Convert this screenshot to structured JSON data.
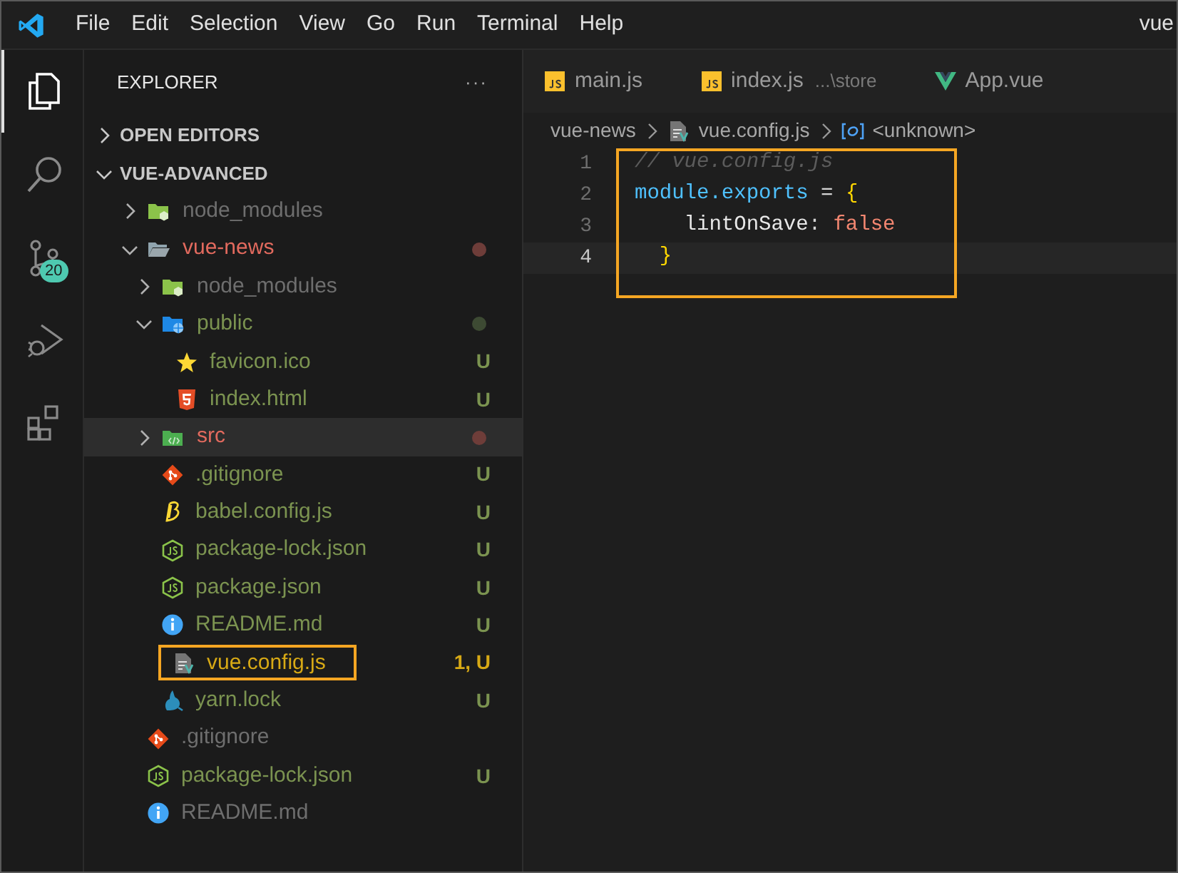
{
  "title_bar": {
    "menu": [
      "File",
      "Edit",
      "Selection",
      "View",
      "Go",
      "Run",
      "Terminal",
      "Help"
    ],
    "title": "vue"
  },
  "activity_bar": [
    {
      "kind": "explorer",
      "selected": true
    },
    {
      "kind": "search",
      "selected": false
    },
    {
      "kind": "source-control",
      "selected": false,
      "badge": "20"
    },
    {
      "kind": "run-debug",
      "selected": false
    },
    {
      "kind": "extensions",
      "selected": false
    }
  ],
  "sidebar": {
    "title": "EXPLORER",
    "more": "···",
    "sections": [
      {
        "label": "OPEN EDITORS",
        "expanded": false
      },
      {
        "label": "VUE-ADVANCED",
        "expanded": true
      }
    ],
    "tree": [
      {
        "name": "node_modules",
        "kind": "node-folder",
        "expanded": false,
        "color": "#6e6e6e",
        "hovered": false,
        "highlighted": false
      },
      {
        "name": "vue-news",
        "kind": "folder",
        "expanded": true,
        "color": "#e26a5e",
        "status_dot": {
          "color": "#6e3d39"
        },
        "hovered": false,
        "highlighted": false,
        "children": [
          {
            "name": "node_modules",
            "kind": "node-folder",
            "expanded": false,
            "color": "#6e6e6e",
            "hovered": false,
            "highlighted": false
          },
          {
            "name": "public",
            "kind": "public-folder",
            "expanded": true,
            "color": "#7b9350",
            "status_dot": {
              "color": "#3d4a33"
            },
            "hovered": false,
            "highlighted": false,
            "children": [
              {
                "name": "favicon.ico",
                "kind": "star",
                "color": "#7b9350",
                "decoration": "U",
                "hovered": false,
                "highlighted": false
              },
              {
                "name": "index.html",
                "kind": "html",
                "color": "#7b9350",
                "decoration": "U",
                "hovered": false,
                "highlighted": false
              }
            ]
          },
          {
            "name": "src",
            "kind": "src-folder",
            "expanded": false,
            "color": "#e26a5e",
            "status_dot": {
              "color": "#6e3d39"
            },
            "hovered": true,
            "highlighted": false
          },
          {
            "name": ".gitignore",
            "kind": "git",
            "color": "#7b9350",
            "decoration": "U",
            "hovered": false,
            "highlighted": false
          },
          {
            "name": "babel.config.js",
            "kind": "babel",
            "color": "#7b9350",
            "decoration": "U",
            "hovered": false,
            "highlighted": false
          },
          {
            "name": "package-lock.json",
            "kind": "node",
            "color": "#7b9350",
            "decoration": "U",
            "hovered": false,
            "highlighted": false
          },
          {
            "name": "package.json",
            "kind": "node",
            "color": "#7b9350",
            "decoration": "U",
            "hovered": false,
            "highlighted": false
          },
          {
            "name": "README.md",
            "kind": "info",
            "color": "#7b9350",
            "decoration": "U",
            "hovered": false,
            "highlighted": false
          },
          {
            "name": "vue.config.js",
            "kind": "vue-config",
            "color": "#d7a915",
            "decoration": "1, U",
            "hovered": false,
            "highlighted": true
          },
          {
            "name": "yarn.lock",
            "kind": "yarn",
            "color": "#7b9350",
            "decoration": "U",
            "hovered": false,
            "highlighted": false
          }
        ]
      },
      {
        "name": ".gitignore",
        "kind": "git",
        "color": "#6e6e6e",
        "hovered": false,
        "highlighted": false
      },
      {
        "name": "package-lock.json",
        "kind": "node",
        "color": "#7b9350",
        "decoration": "U",
        "hovered": false,
        "highlighted": false
      },
      {
        "name": "README.md",
        "kind": "info",
        "color": "#6e6e6e",
        "hovered": false,
        "highlighted": false
      }
    ]
  },
  "tabs": [
    {
      "label": "main.js",
      "kind": "js",
      "selected": false
    },
    {
      "label": "index.js",
      "description": "...\\store",
      "kind": "js",
      "selected": false
    },
    {
      "label": "App.vue",
      "kind": "vue",
      "selected": false
    }
  ],
  "breadcrumbs": [
    {
      "label": "vue-news",
      "kind": "folder-name"
    },
    {
      "label": "vue.config.js",
      "kind": "vue-config"
    },
    {
      "label": "<unknown>",
      "kind": "symbol"
    }
  ],
  "editor": {
    "highlighted": true,
    "lines": [
      {
        "number": "1",
        "active": false,
        "tokens": [
          {
            "text": "// vue.config.js",
            "kind": "comment"
          }
        ]
      },
      {
        "number": "2",
        "active": false,
        "tokens": [
          {
            "text": "module.exports",
            "kind": "variable"
          },
          {
            "text": " = ",
            "kind": "operator"
          },
          {
            "text": "{",
            "kind": "bracket"
          }
        ]
      },
      {
        "number": "3",
        "active": false,
        "tokens": [
          {
            "text": "    lintOnSave",
            "kind": "property"
          },
          {
            "text": ": ",
            "kind": "operator"
          },
          {
            "text": "false",
            "kind": "keyword"
          }
        ]
      },
      {
        "number": "4",
        "active": true,
        "tokens": [
          {
            "text": "  }",
            "kind": "bracket"
          }
        ]
      }
    ]
  }
}
